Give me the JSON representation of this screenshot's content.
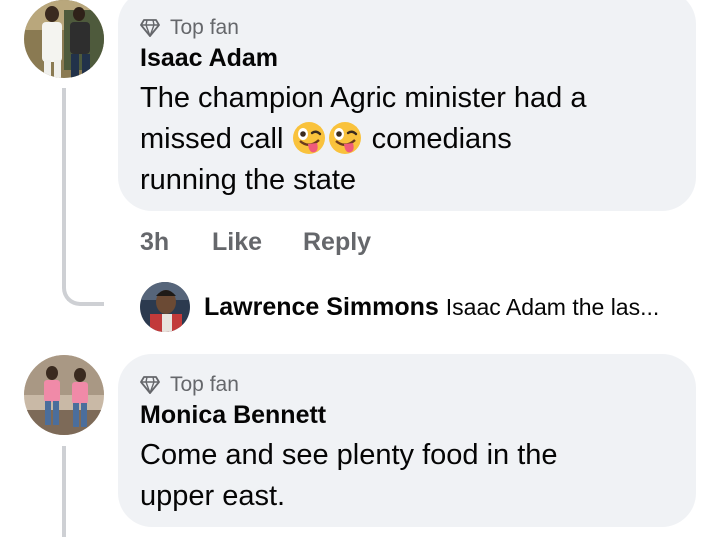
{
  "comments": [
    {
      "badge": "Top fan",
      "author": "Isaac Adam",
      "text_line1": "The champion Agric minister had a",
      "text_line2_pre": "missed call",
      "text_line2_post": "comedians",
      "text_line3": "running the state",
      "emoji": "winking-face-with-tongue",
      "time": "3h",
      "like_label": "Like",
      "reply_label": "Reply"
    },
    {
      "badge": "Top fan",
      "author": "Monica Bennett",
      "text_line1": "Come and see plenty food in the",
      "text_line2": "upper east."
    }
  ],
  "reply_preview": {
    "author": "Lawrence Simmons",
    "text": "Isaac Adam the las..."
  },
  "colors": {
    "bubble": "#f0f2f5",
    "secondary_text": "#65676b",
    "thread_line": "#ced0d4"
  }
}
